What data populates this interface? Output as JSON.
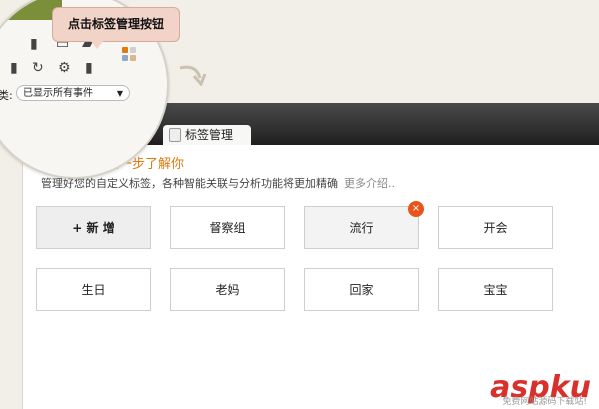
{
  "callout": {
    "text": "点击标签管理按钮"
  },
  "lens": {
    "category_label": "类:",
    "select_value": "已显示所有事件"
  },
  "tab": {
    "label": "标签管理"
  },
  "promo": {
    "title": "时光笔记您进一步了解你",
    "desc": "管理好您的自定义标签，各种智能关联与分析功能将更加精确",
    "more": "更多介绍.."
  },
  "tags": {
    "add": "+ 新 增",
    "t1": "督察组",
    "t2": "流行",
    "t3": "开会",
    "t4": "生日",
    "t5": "老妈",
    "t6": "回家",
    "t7": "宝宝",
    "delete": "×"
  },
  "watermark": {
    "logo": "aspku",
    "sub": "免费网站源码下载站!"
  },
  "colors": {
    "accent": "#e07a10",
    "delete": "#e8551a",
    "tabbar": "#2b2b2b"
  }
}
